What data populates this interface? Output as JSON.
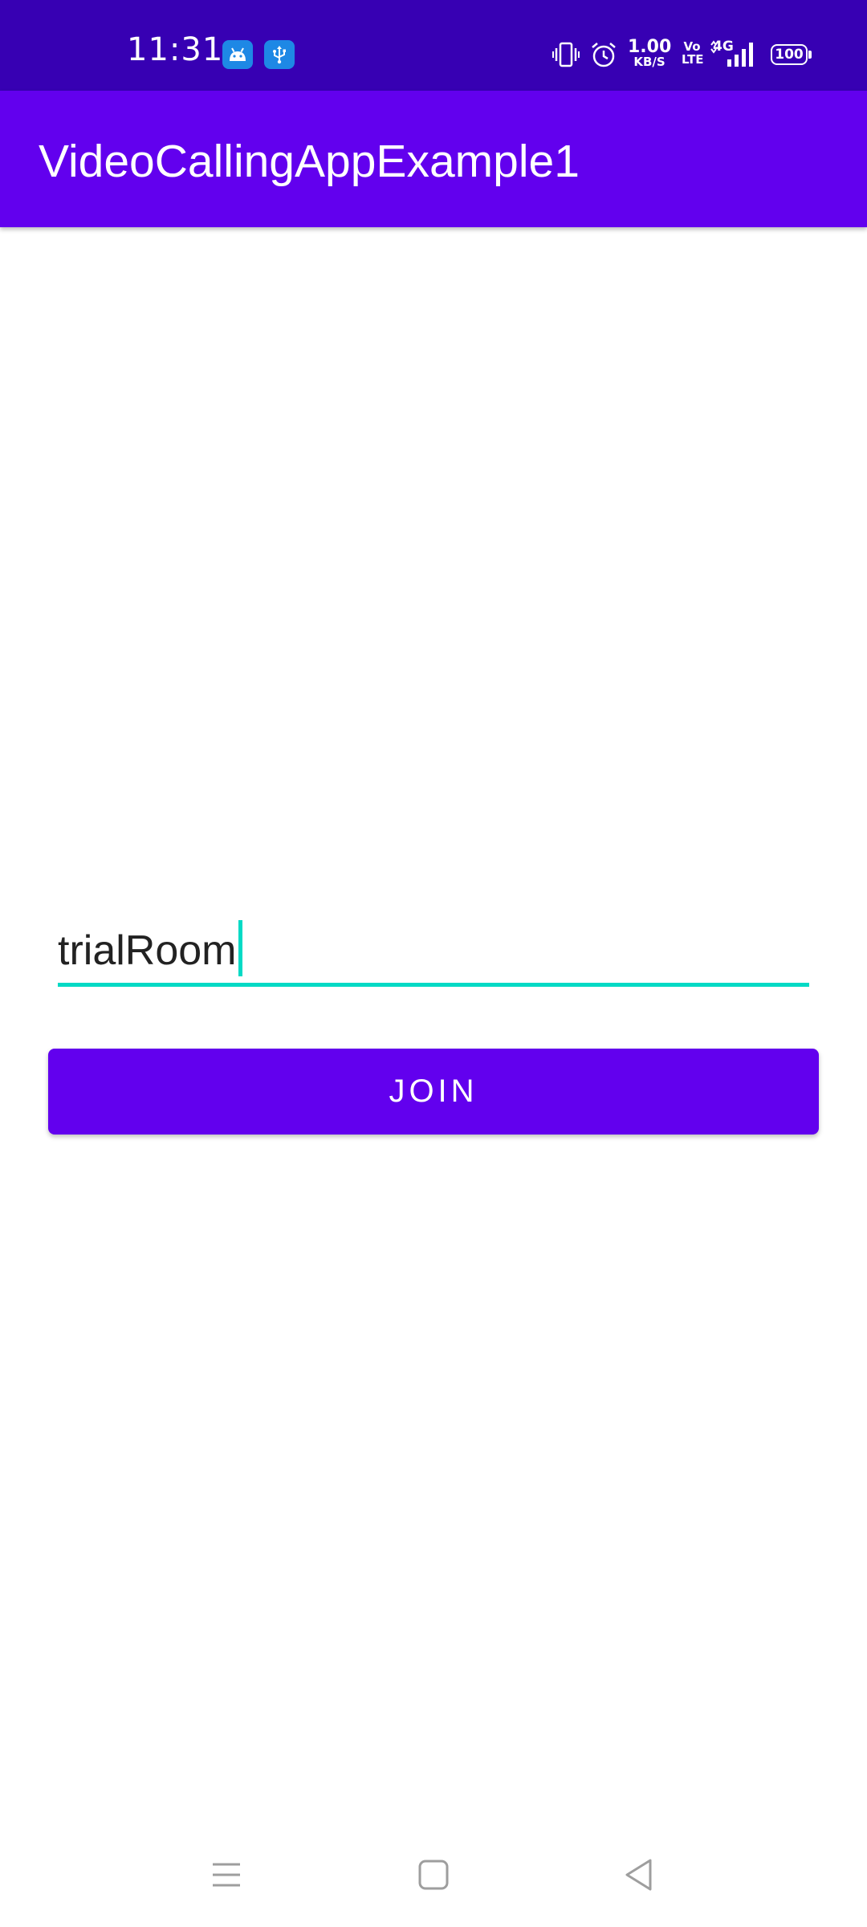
{
  "status_bar": {
    "time": "11:31",
    "net_speed_value": "1.00",
    "net_speed_unit": "KB/S",
    "volte_line1": "Vo",
    "volte_line2": "LTE",
    "network_type": "4G",
    "battery_level": "100",
    "notification_icons": [
      "android-icon",
      "usb-icon"
    ],
    "status_icons": [
      "vibrate-icon",
      "alarm-icon",
      "signal-icon"
    ]
  },
  "app_bar": {
    "title": "VideoCallingAppExample1"
  },
  "room_input": {
    "value": "trialRoom"
  },
  "join_button": {
    "label": "JOIN"
  },
  "nav_bar": {
    "buttons": [
      "menu-icon",
      "home-icon",
      "back-icon"
    ]
  },
  "colors": {
    "status_bar": "#3700b3",
    "primary": "#6200ee",
    "accent": "#03dac5",
    "background": "#ffffff"
  }
}
